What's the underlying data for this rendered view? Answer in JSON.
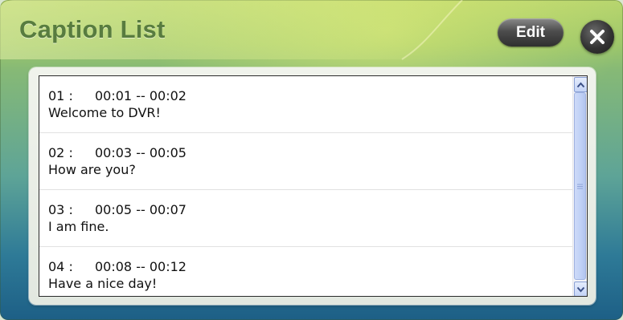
{
  "window": {
    "title": "Caption List",
    "edit_label": "Edit",
    "colors": {
      "accent": "#587c3f",
      "background_top": "#b9d66e",
      "background_bottom": "#1d5f86"
    }
  },
  "captions": [
    {
      "index": "01 :",
      "time": "00:01 -- 00:02",
      "text": "Welcome to DVR!"
    },
    {
      "index": "02 :",
      "time": "00:03 -- 00:05",
      "text": "How are you?"
    },
    {
      "index": "03 :",
      "time": "00:05 -- 00:07",
      "text": "I am fine."
    },
    {
      "index": "04 :",
      "time": "00:08 -- 00:12",
      "text": "Have a nice day!"
    }
  ],
  "icons": {
    "close": "close-icon",
    "scroll_up": "chevron-up-icon",
    "scroll_down": "chevron-down-icon",
    "thumb_grip": "grip-lines-icon"
  }
}
